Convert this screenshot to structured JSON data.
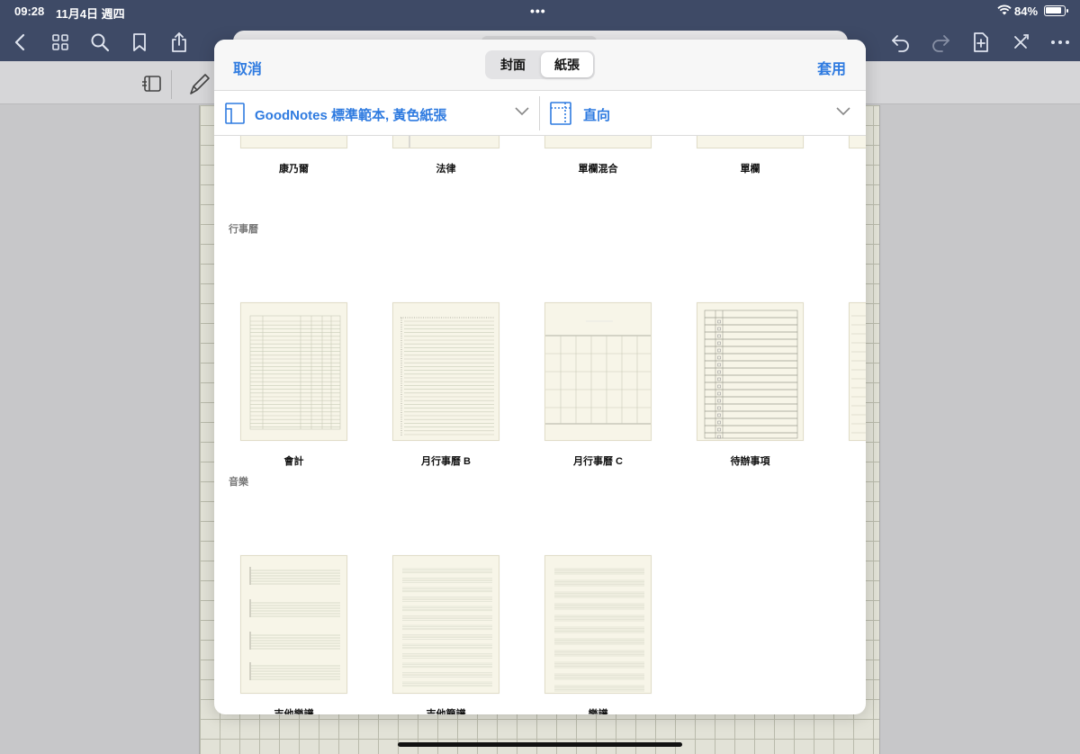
{
  "status": {
    "time": "09:28",
    "date": "11月4日 週四",
    "dots": "•••",
    "battery": "84%"
  },
  "nav": {
    "left_icons": [
      "back-icon",
      "grid-icon",
      "search-icon",
      "bookmark-icon",
      "share-icon"
    ],
    "right_icons": [
      "undo-icon",
      "redo-icon",
      "add-page-icon",
      "close-toolbar-icon",
      "more-icon"
    ]
  },
  "modal": {
    "cancel": "取消",
    "apply": "套用",
    "segments": [
      "封面",
      "紙張"
    ],
    "template_select": "GoodNotes 標準範本, 黃色紙張",
    "orientation_select": "直向"
  },
  "sections": {
    "top_row": [
      "康乃爾",
      "法律",
      "單欄混合",
      "單欄"
    ],
    "calendar_title": "行事曆",
    "calendar": [
      "會計",
      "月行事曆 B",
      "月行事曆 C",
      "待辦事項"
    ],
    "music_title": "音樂",
    "music": [
      "吉他樂譜",
      "吉他簡譜",
      "樂譜"
    ]
  },
  "colors": {
    "accent": "#2f7be0",
    "nav_bg": "#3e4a66",
    "paper": "#f7f5e8"
  }
}
